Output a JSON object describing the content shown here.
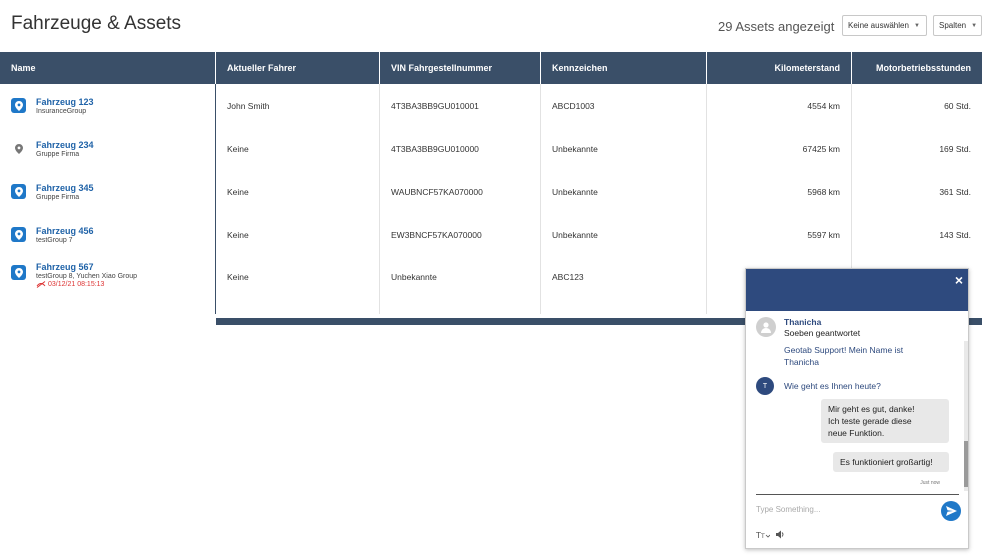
{
  "header": {
    "title": "Fahrzeuge & Assets",
    "count_label": "29 Assets angezeigt",
    "select_button": "Keine auswählen",
    "columns_button": "Spalten"
  },
  "table": {
    "columns": [
      "Name",
      "Aktueller Fahrer",
      "VIN Fahrgestellnummer",
      "Kennzeichen",
      "Kilometerstand",
      "Motorbetriebsstunden"
    ],
    "rows": [
      {
        "name": "Fahrzeug 123",
        "group": "InsuranceGroup",
        "alert": "",
        "driver": "John Smith",
        "vin": "4T3BA3BB9GU010001",
        "plate": "ABCD1003",
        "km": "4554 km",
        "hours": "60 Std.",
        "icon": "map-pin-icon"
      },
      {
        "name": "Fahrzeug 234",
        "group": "Gruppe Firma",
        "alert": "",
        "driver": "Keine",
        "vin": "4T3BA3BB9GU010000",
        "plate": "Unbekannte",
        "km": "67425 km",
        "hours": "169 Std.",
        "icon": "map-pin-grey-icon"
      },
      {
        "name": "Fahrzeug 345",
        "group": "Gruppe Firma",
        "alert": "",
        "driver": "Keine",
        "vin": "WAUBNCF57KA070000",
        "plate": "Unbekannte",
        "km": "5968 km",
        "hours": "361 Std.",
        "icon": "map-pin-icon"
      },
      {
        "name": "Fahrzeug 456",
        "group": "testGroup 7",
        "alert": "",
        "driver": "Keine",
        "vin": "EW3BNCF57KA070000",
        "plate": "Unbekannte",
        "km": "5597 km",
        "hours": "143 Std.",
        "icon": "map-pin-icon"
      },
      {
        "name": "Fahrzeug 567",
        "group": "testGroup 8, Yuchen Xiao Group",
        "alert": "03/12/21 08:15:13",
        "driver": "Keine",
        "vin": "Unbekannte",
        "plate": "ABC123",
        "km": "",
        "hours": "",
        "icon": "map-pin-icon"
      }
    ]
  },
  "chat": {
    "agent_name": "Thanicha",
    "agent_status": "Soeben geantwortet",
    "agent_msg_1_line1": "Geotab Support! Mein Name ist",
    "agent_msg_1_line2": "Thanicha",
    "agent_initial": "T",
    "agent_msg_2": "Wie geht es Ihnen heute?",
    "user_msg_1_line1": "Mir geht es gut, danke!",
    "user_msg_1_line2": "Ich teste gerade diese",
    "user_msg_1_line3": "neue Funktion.",
    "user_msg_2": "Es funktioniert großartig!",
    "timestamp": "Just now",
    "input_placeholder": "Type Something...",
    "close_label": "×"
  },
  "colors": {
    "header_bg": "#3a4f68",
    "chat_header_bg": "#2e4a7e",
    "link_blue": "#2063a8",
    "accent_blue": "#1f78c8",
    "alert_red": "#dd3333"
  }
}
